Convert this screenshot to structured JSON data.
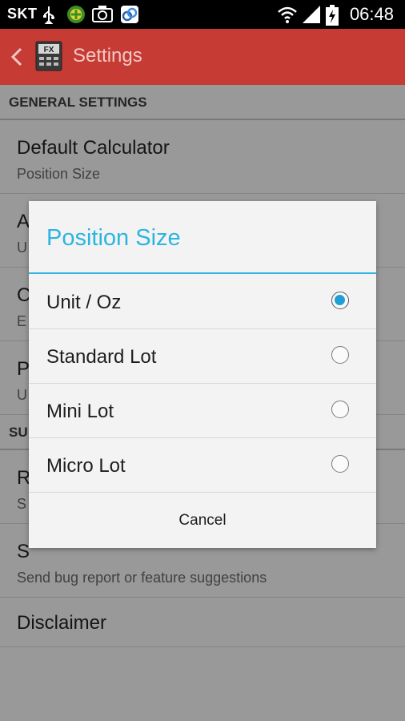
{
  "status_bar": {
    "carrier": "SKT",
    "time": "06:48",
    "icons": [
      "usb-icon",
      "app-icon",
      "camera-icon",
      "screenshot-app-icon",
      "wifi-icon",
      "signal-icon",
      "battery-charging-icon"
    ]
  },
  "action_bar": {
    "title": "Settings",
    "app_icon_text": "FX",
    "color": "#c63b34"
  },
  "settings": {
    "section_general": "GENERAL SETTINGS",
    "items": [
      {
        "title": "Default Calculator",
        "subtitle": "Position Size"
      },
      {
        "title": "A",
        "subtitle": "U"
      },
      {
        "title": "C",
        "subtitle": "E"
      },
      {
        "title": "P",
        "subtitle": "U"
      }
    ],
    "section_support": "SU",
    "support_items": [
      {
        "title": "R",
        "subtitle": "S"
      },
      {
        "title": "S",
        "subtitle": "Send bug report or feature suggestions"
      },
      {
        "title": "Disclaimer"
      }
    ]
  },
  "dialog": {
    "title": "Position Size",
    "accent": "#33b5e5",
    "options": [
      {
        "label": "Unit / Oz",
        "selected": true
      },
      {
        "label": "Standard Lot",
        "selected": false
      },
      {
        "label": "Mini Lot",
        "selected": false
      },
      {
        "label": "Micro Lot",
        "selected": false
      }
    ],
    "cancel_label": "Cancel"
  }
}
